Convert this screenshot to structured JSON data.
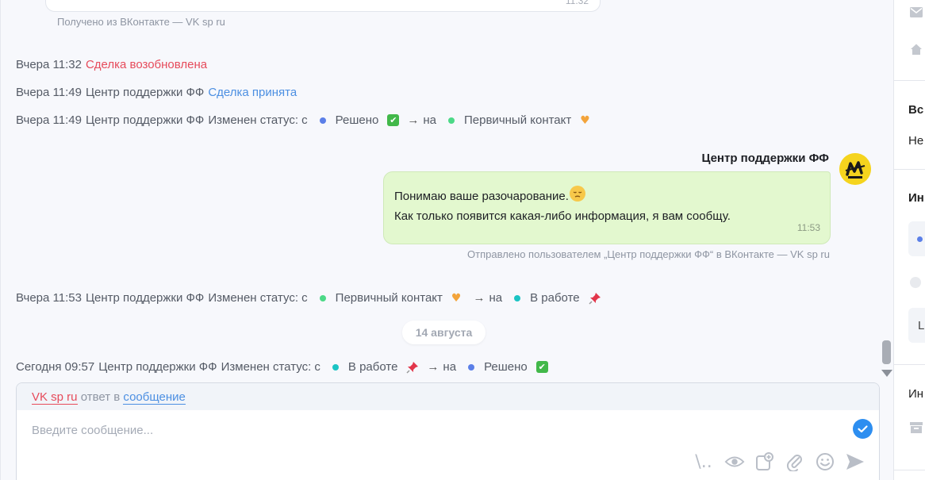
{
  "prev_message": {
    "time": "11:32",
    "source_note": "Получено из ВКонтакте — VK sp ru"
  },
  "events": [
    {
      "date": "Вчера 11:32",
      "text": "Сделка возобновлена"
    },
    {
      "date": "Вчера 11:49",
      "author": "Центр поддержки ФФ",
      "text": "Сделка принята"
    },
    {
      "date": "Вчера 11:49",
      "author": "Центр поддержки ФФ",
      "text": "Изменен статус: с",
      "from": "Решено",
      "to_word": "на",
      "to": "Первичный контакт"
    },
    {
      "date": "Вчера 11:53",
      "author": "Центр поддержки ФФ",
      "text": "Изменен статус: с",
      "from": "Первичный контакт",
      "to_word": "на",
      "to": "В работе"
    },
    {
      "date": "Сегодня 09:57",
      "author": "Центр поддержки ФФ",
      "text": "Изменен статус: с",
      "from": "В работе",
      "to_word": "на",
      "to": "Решено"
    }
  ],
  "message": {
    "sender": "Центр поддержки ФФ",
    "line1": "Понимаю ваше разочарование.",
    "line2": "Как только появится какая-либо информация, я вам сообщу.",
    "time": "11:53",
    "source_note": "Отправлено пользователем „Центр поддержки ФФ“ в ВКонтакте — VK sp ru"
  },
  "date_separator": "14 августа",
  "composer": {
    "reply_channel": "VK sp ru",
    "reply_mid": "ответ в",
    "reply_target": "сообщение",
    "placeholder": "Введите сообщение..."
  },
  "right_panel": {
    "item1": "Вс",
    "item2": "Не",
    "item3": "Ин",
    "item4": "L",
    "item5": "Ин"
  },
  "colors": {
    "status_resolved": "#5b7fe8",
    "status_primary": "#4cd987",
    "status_in_work": "#1bc4c4",
    "accent_red": "#e64b5b",
    "accent_blue": "#4c8fe2",
    "bubble_green": "#e3f8cf"
  },
  "icons": [
    "mail-icon",
    "home-icon",
    "smile-face-icon",
    "check-box-icon",
    "orange-heart-icon",
    "pushpin-icon",
    "eye-icon",
    "template-icon",
    "paperclip-icon",
    "emoji-icon",
    "send-icon",
    "check-circle-icon",
    "archive-icon"
  ]
}
